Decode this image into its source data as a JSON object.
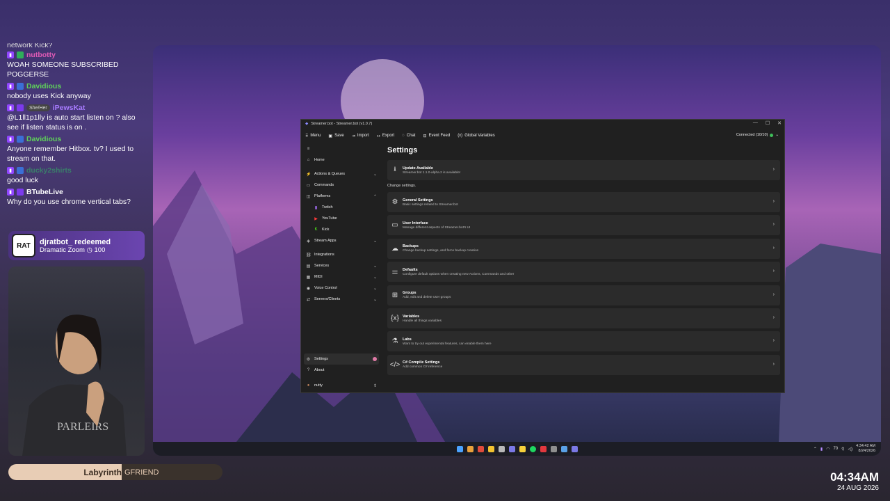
{
  "chat": {
    "cut_text": "network Kick?",
    "messages": [
      {
        "user": "nutbotty",
        "color": "#e05bb6",
        "badges": [
          "twitch",
          "green"
        ],
        "text": "WOAH SOMEONE SUBSCRIBED POGGERSE"
      },
      {
        "user": "Davidious",
        "color": "#5fd35a",
        "badges": [
          "twitch",
          "blue"
        ],
        "text": "nobody uses Kick anyway"
      },
      {
        "user": "iPewsKat",
        "color": "#a87bff",
        "badges": [
          "twitch",
          "purple"
        ],
        "pronoun": "She/Her",
        "text": "@L1ll1p1lly is auto start listen on ? also see if listen status is on ."
      },
      {
        "user": "Davidious",
        "color": "#5fd35a",
        "badges": [
          "twitch",
          "blue"
        ],
        "text": "Anyone remember Hitbox. tv? I used to stream on that."
      },
      {
        "user": "ducky2shirts",
        "color": "#3a7f6a",
        "badges": [
          "twitch",
          "blue"
        ],
        "text": "good luck"
      },
      {
        "user": "BTubeLive",
        "color": "#ffffff",
        "badges": [
          "twitch",
          "purple"
        ],
        "text": "Why do you use chrome vertical tabs?"
      }
    ]
  },
  "redeem": {
    "logo": "RAT",
    "title": "djratbot_ redeemed",
    "reward": "Dramatic Zoom",
    "cost": "100"
  },
  "music": {
    "song": "Labyrinth",
    "artist": "GFRIEND",
    "progress": 0.53
  },
  "stream_clock": {
    "time": "04:34AM",
    "date": "24 AUG 2026"
  },
  "window": {
    "title": "Streamer.bot - Streamer.bot (v1.0.7)",
    "controls": [
      "—",
      "☐",
      "✕"
    ],
    "menu": [
      {
        "icon": "grid-icon",
        "label": "Menu"
      },
      {
        "icon": "save-icon",
        "label": "Save"
      },
      {
        "icon": "import-icon",
        "label": "Import"
      },
      {
        "icon": "export-icon",
        "label": "Export"
      },
      {
        "icon": "chat-icon",
        "label": "Chat"
      },
      {
        "icon": "event-feed-icon",
        "label": "Event Feed"
      },
      {
        "icon": "variables-icon",
        "label": "Global Variables"
      }
    ],
    "connection": "Connected (10/10)",
    "sidebar": {
      "hamburger": "≡",
      "items": [
        {
          "label": "Home",
          "icon": "⌂"
        },
        {
          "label": "Actions & Queues",
          "icon": "⚡",
          "chevron": true
        },
        {
          "label": "Commands",
          "icon": "▭"
        },
        {
          "label": "Platforms",
          "icon": "◫",
          "chevron": true,
          "expanded": true
        },
        {
          "label": "Twitch",
          "icon": "▮",
          "sub": true
        },
        {
          "label": "YouTube",
          "icon": "▶",
          "sub": true
        },
        {
          "label": "Kick",
          "icon": "K",
          "sub": true
        },
        {
          "label": "Stream Apps",
          "icon": "◈",
          "chevron": true
        },
        {
          "label": "Integrations",
          "icon": "⛓"
        },
        {
          "label": "Services",
          "icon": "▤",
          "chevron": true
        },
        {
          "label": "MIDI",
          "icon": "▦",
          "chevron": true
        },
        {
          "label": "Voice Control",
          "icon": "◉",
          "chevron": true
        },
        {
          "label": "Servers/Clients",
          "icon": "⇄",
          "chevron": true
        }
      ],
      "bottom": [
        {
          "label": "Settings",
          "icon": "⚙"
        },
        {
          "label": "About",
          "icon": "?"
        },
        {
          "label": "nutty",
          "icon": "●"
        }
      ]
    },
    "content": {
      "title": "Settings",
      "update": {
        "title": "Update Available",
        "desc": "Streamer.bot 1.1.0-alpha.2 is available!"
      },
      "section_label": "Change settings.",
      "cards": [
        {
          "icon": "⚙",
          "title": "General Settings",
          "desc": "Basic settings related to Streamer.bot"
        },
        {
          "icon": "▭",
          "title": "User Interface",
          "desc": "Manage different aspects of Streamer.bot's UI"
        },
        {
          "icon": "☁",
          "title": "Backups",
          "desc": "Change backup settings, and force backup creation"
        },
        {
          "icon": "⚌",
          "title": "Defaults",
          "desc": "Configure default options when creating new Actions, Commands and other"
        },
        {
          "icon": "⊞",
          "title": "Groups",
          "desc": "Add, edit and delete user groups"
        },
        {
          "icon": "{x}",
          "title": "Variables",
          "desc": "Handle all things variables"
        },
        {
          "icon": "⚗",
          "title": "Labs",
          "desc": "Want to try out experimental features, can enable them here"
        },
        {
          "icon": "</>",
          "title": "C# Compile Settings",
          "desc": "Add common C# reference"
        }
      ]
    }
  },
  "tray": {
    "battery": "70",
    "time": "4:34:42 AM",
    "date": "8/24/2026"
  }
}
